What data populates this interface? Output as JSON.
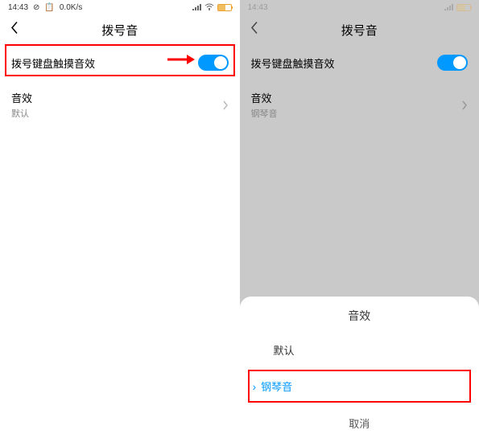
{
  "status": {
    "time": "14:43",
    "speed": "0.0K/s"
  },
  "header": {
    "title": "拨号音"
  },
  "rows": {
    "touch_sound": {
      "label": "拨号键盘触摸音效"
    },
    "effect_left": {
      "label": "音效",
      "sub": "默认"
    },
    "effect_right": {
      "label": "音效",
      "sub": "钢琴音"
    }
  },
  "sheet": {
    "title": "音效",
    "option_default": "默认",
    "option_piano": "钢琴音",
    "cancel": "取消"
  }
}
